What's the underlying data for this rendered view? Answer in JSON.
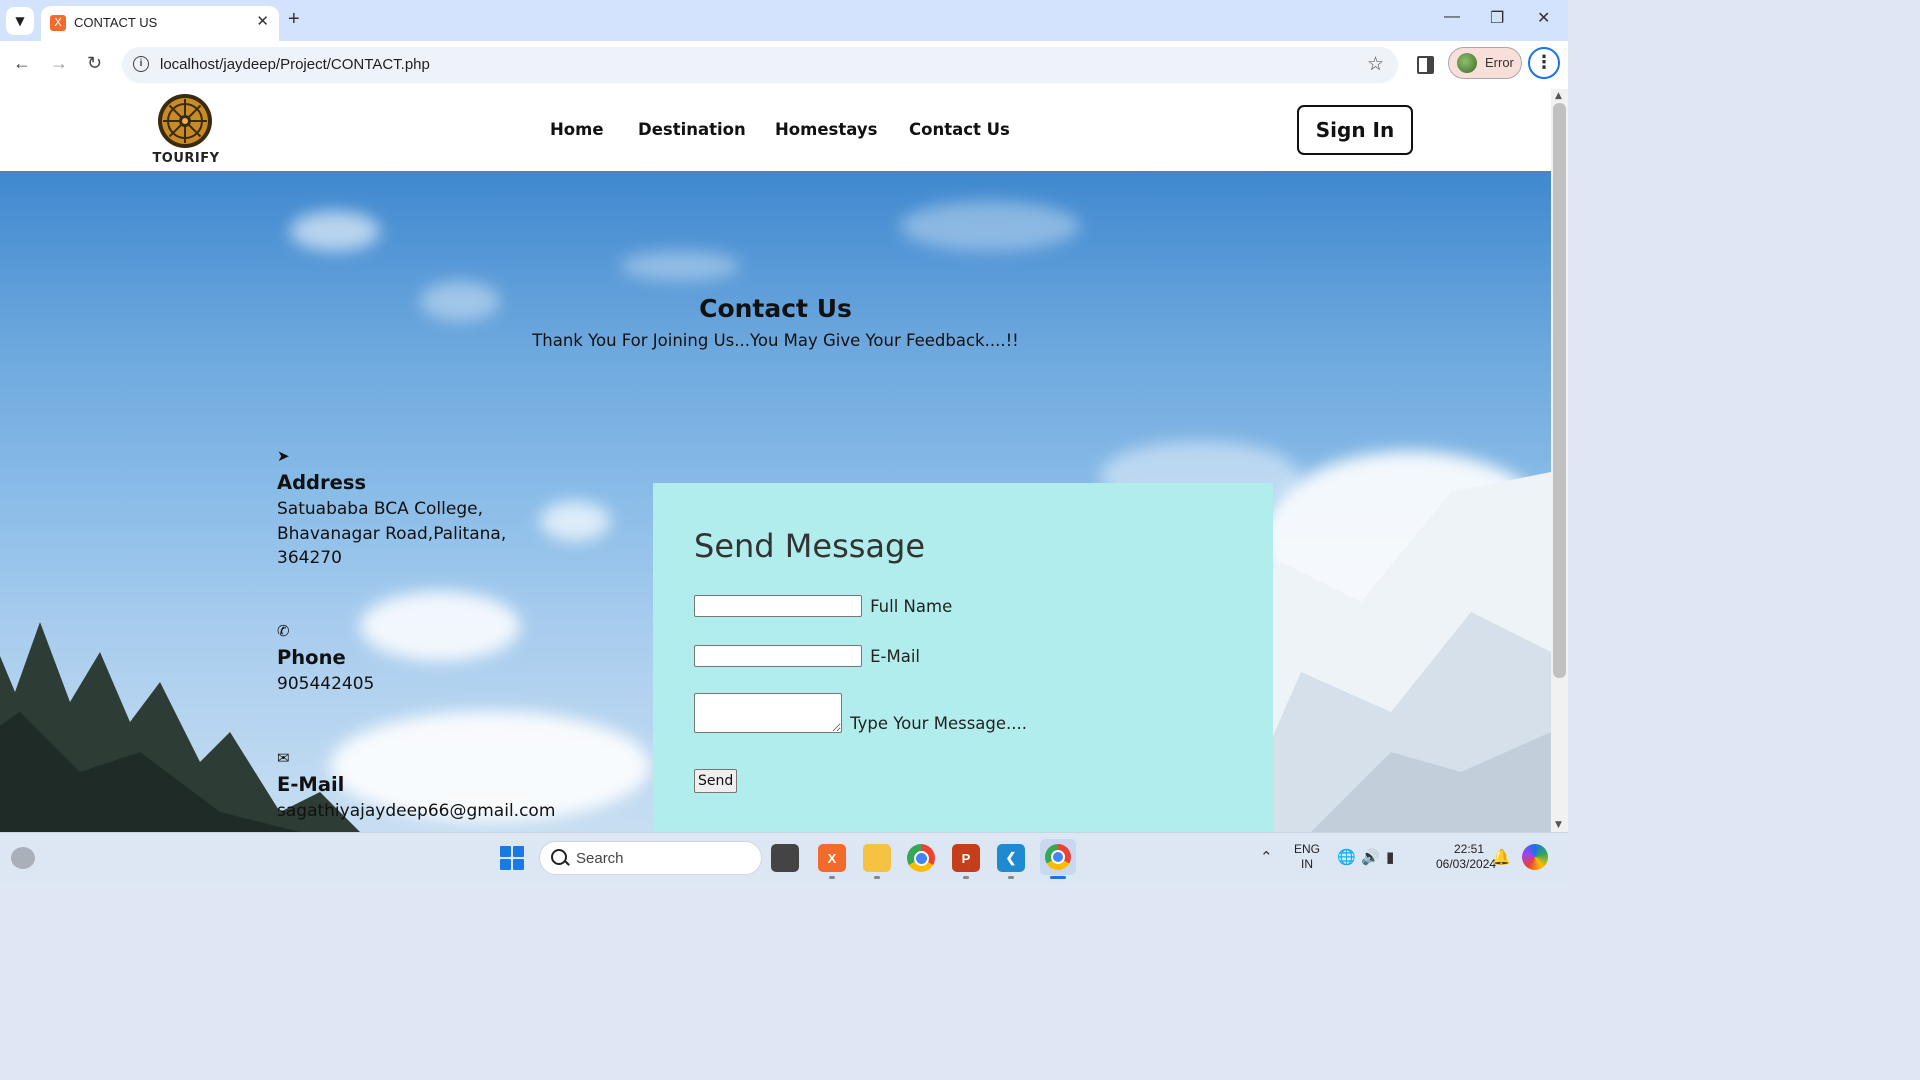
{
  "browser": {
    "tab_title": "CONTACT US",
    "favicon_glyph": "X",
    "url": "localhost/jaydeep/Project/CONTACT.php",
    "profile_label": "Error"
  },
  "site": {
    "logo_text": "TOURIFY",
    "nav": {
      "home": "Home",
      "destination": "Destination",
      "homestays": "Homestays",
      "contact": "Contact Us"
    },
    "signin_label": "Sign In"
  },
  "hero": {
    "title": "Contact Us",
    "subtitle": "Thank You For Joining Us...You May Give Your Feedback....!!"
  },
  "contact_info": {
    "address_heading": "Address",
    "address_line1": "Satuababa BCA College,",
    "address_line2": "Bhavanagar Road,Palitana,",
    "address_line3": "364270",
    "phone_heading": "Phone",
    "phone_value": "905442405",
    "email_heading": "E-Mail",
    "email_value": "sagathiyajaydeep66@gmail.com"
  },
  "form": {
    "title": "Send Message",
    "name_label": "Full Name",
    "email_label": "E-Mail",
    "message_label": "Type Your Message....",
    "send_label": "Send",
    "name_value": "",
    "email_value": "",
    "message_value": ""
  },
  "taskbar": {
    "search_label": "Search",
    "lang_line1": "ENG",
    "lang_line2": "IN",
    "time": "22:51",
    "date": "06/03/2024",
    "apps": [
      "file-explorer-icon",
      "xampp-icon",
      "folder-icon",
      "chrome-icon",
      "powerpoint-icon",
      "vscode-icon",
      "chrome-profile-icon"
    ]
  },
  "colors": {
    "form_card": "#b2eded",
    "sky_top": "#3f88cf",
    "accent_blue": "#1a73e8"
  }
}
